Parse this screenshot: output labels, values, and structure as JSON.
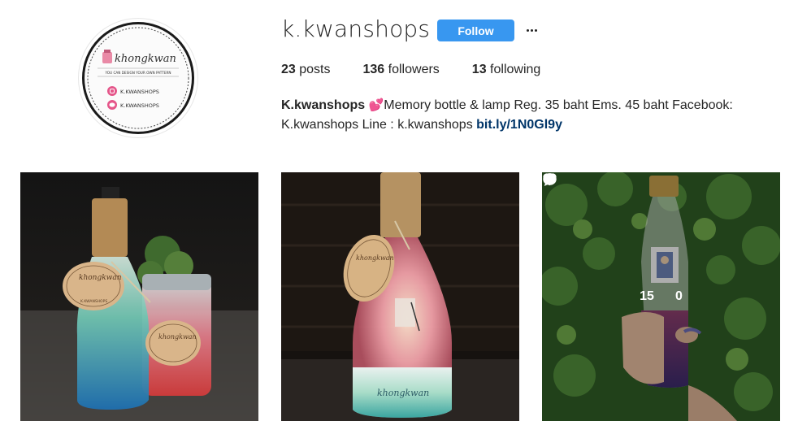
{
  "profile": {
    "username": "k.kwanshops",
    "follow_label": "Follow",
    "avatar": {
      "logo_text": "khongkwan",
      "tagline": "YOU CAN DESIGN YOUR OWN PATTERN",
      "line1": "K.KWANSHOPS",
      "line2": "K.KWANSHOPS"
    }
  },
  "stats": {
    "posts_count": "23",
    "posts_label": "posts",
    "followers_count": "136",
    "followers_label": "followers",
    "following_count": "13",
    "following_label": "following"
  },
  "bio": {
    "name": "K.kwanshops",
    "heart": "💕",
    "text": "Memory bottle & lamp Reg. 35 baht Ems. 45 baht Facebook: K.kwanshops Line : k.kwanshops",
    "link": "bit.ly/1N0Gl9y"
  },
  "posts": [
    {
      "tag": "khongkwan",
      "tag2": "K.KWANSHOPS"
    },
    {
      "tag": "khongkwan"
    },
    {
      "likes": "15",
      "comments": "0"
    }
  ],
  "colors": {
    "follow_button": "#3897f0",
    "link": "#003569",
    "text": "#262626"
  },
  "icons": [
    "more-icon",
    "heart-icon",
    "comment-icon"
  ]
}
